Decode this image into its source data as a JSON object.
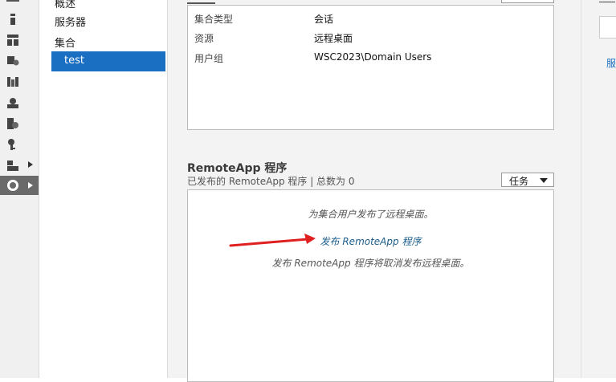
{
  "nav": {
    "items": [
      "概述",
      "服务器",
      "集合"
    ],
    "selected": "test"
  },
  "properties": {
    "rows": [
      {
        "label": "集合类型",
        "value": "会话"
      },
      {
        "label": "资源",
        "value": "远程桌面"
      },
      {
        "label": "用户组",
        "value": "WSC2023\\Domain Users"
      }
    ]
  },
  "remoteapp": {
    "title": "RemoteApp 程序",
    "subtitle": "已发布的 RemoteApp 程序 | 总数为 0",
    "tasks_label": "任务",
    "message": "为集合用户发布了远程桌面。",
    "publish_link": "发布 RemoteApp 程序",
    "note": "发布 RemoteApp 程序将取消发布远程桌面。"
  },
  "right": {
    "link_fragment": "服"
  },
  "colors": {
    "selected": "#1a6fc2",
    "link": "#1a5c8a",
    "arrow": "#e02020"
  },
  "icons": [
    "dashboard-icon",
    "local-server-icon",
    "all-servers-icon",
    "ad-ds-icon",
    "file-services-icon",
    "print-icon",
    "ad-cs-icon",
    "key-icon",
    "iis-icon",
    "remote-desktop-icon"
  ]
}
